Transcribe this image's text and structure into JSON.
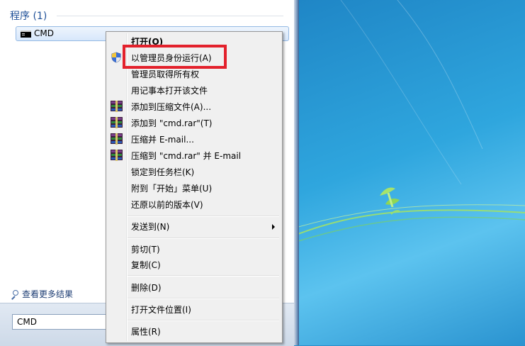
{
  "start_menu": {
    "section_header": "程序 (1)",
    "result_item": {
      "label": "CMD",
      "icon": "cmd-icon"
    },
    "more_results": {
      "label": "查看更多结果",
      "icon": "search-icon"
    },
    "search_input": {
      "value": "CMD"
    }
  },
  "context_menu": {
    "items": [
      {
        "label": "打开(O)",
        "bold": true
      },
      {
        "label": "以管理员身份运行(A)",
        "icon": "uac-shield-icon",
        "highlighted": true
      },
      {
        "label": "管理员取得所有权"
      },
      {
        "label": "用记事本打开该文件"
      },
      {
        "label": "添加到压缩文件(A)...",
        "icon": "winrar-icon"
      },
      {
        "label": "添加到 \"cmd.rar\"(T)",
        "icon": "winrar-icon"
      },
      {
        "label": "压缩并 E-mail...",
        "icon": "winrar-icon"
      },
      {
        "label": "压缩到 \"cmd.rar\" 并 E-mail",
        "icon": "winrar-icon"
      },
      {
        "label": "锁定到任务栏(K)"
      },
      {
        "label": "附到「开始」菜单(U)"
      },
      {
        "label": "还原以前的版本(V)"
      },
      {
        "label": "发送到(N)",
        "submenu": true
      },
      {
        "label": "剪切(T)"
      },
      {
        "label": "复制(C)"
      },
      {
        "label": "删除(D)"
      },
      {
        "label": "打开文件位置(I)"
      },
      {
        "label": "属性(R)"
      }
    ]
  },
  "colors": {
    "highlight_border": "#e3212c",
    "desktop_blue": "#2fa6de",
    "header_text": "#1e4f97"
  }
}
